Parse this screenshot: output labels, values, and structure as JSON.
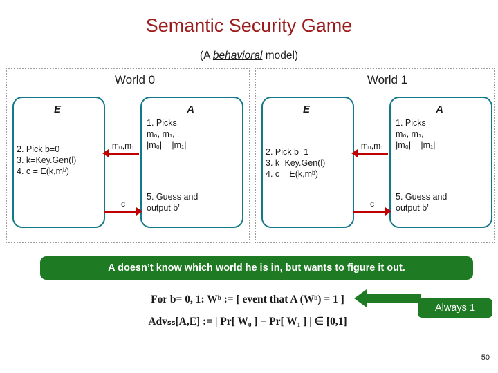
{
  "title": "Semantic Security Game",
  "subtitle_pre": "(A ",
  "subtitle_em": "behavioral",
  "subtitle_post": " model)",
  "worlds": [
    {
      "label": "World 0",
      "challenger": {
        "letter": "E",
        "lines": [
          "2. Pick b=0",
          "3. k=Key.Gen(l)",
          "4. c = E(k,mᵇ)"
        ]
      },
      "adversary": {
        "letter": "A",
        "top_lines": [
          "1. Picks",
          "m₀, m₁,",
          "|m₀| = |m₁|"
        ],
        "bottom_lines": [
          "5. Guess and",
          "output b’"
        ]
      },
      "messages": {
        "top": "m₀,m₁",
        "bottom": "c"
      }
    },
    {
      "label": "World 1",
      "challenger": {
        "letter": "E",
        "lines": [
          "2. Pick b=1",
          "3. k=Key.Gen(l)",
          "4. c = E(k,mᵇ)"
        ]
      },
      "adversary": {
        "letter": "A",
        "top_lines": [
          "1. Picks",
          "m₀, m₁,",
          "|m₀| = |m₁|"
        ],
        "bottom_lines": [
          "5. Guess and",
          "output b’"
        ]
      },
      "messages": {
        "top": "m₀,m₁",
        "bottom": "c"
      }
    }
  ],
  "banner": {
    "text": "A doesn’t know which world he is in, but wants to figure it out."
  },
  "formula": {
    "line1": "For b= 0, 1:  Wᵇ := [ event that A (Wᵇ) = 1 ]",
    "line2": "Advₛₛ[A,E] := | Pr[ W₀ ] −  Pr[ W₁ ] |    ∈ [0,1]"
  },
  "callout": {
    "label": "Always 1"
  },
  "page_number": "50",
  "colors": {
    "title": "#9c1b1b",
    "box_border": "#14788b",
    "arrow": "#c00000",
    "banner": "#1f7a24"
  }
}
